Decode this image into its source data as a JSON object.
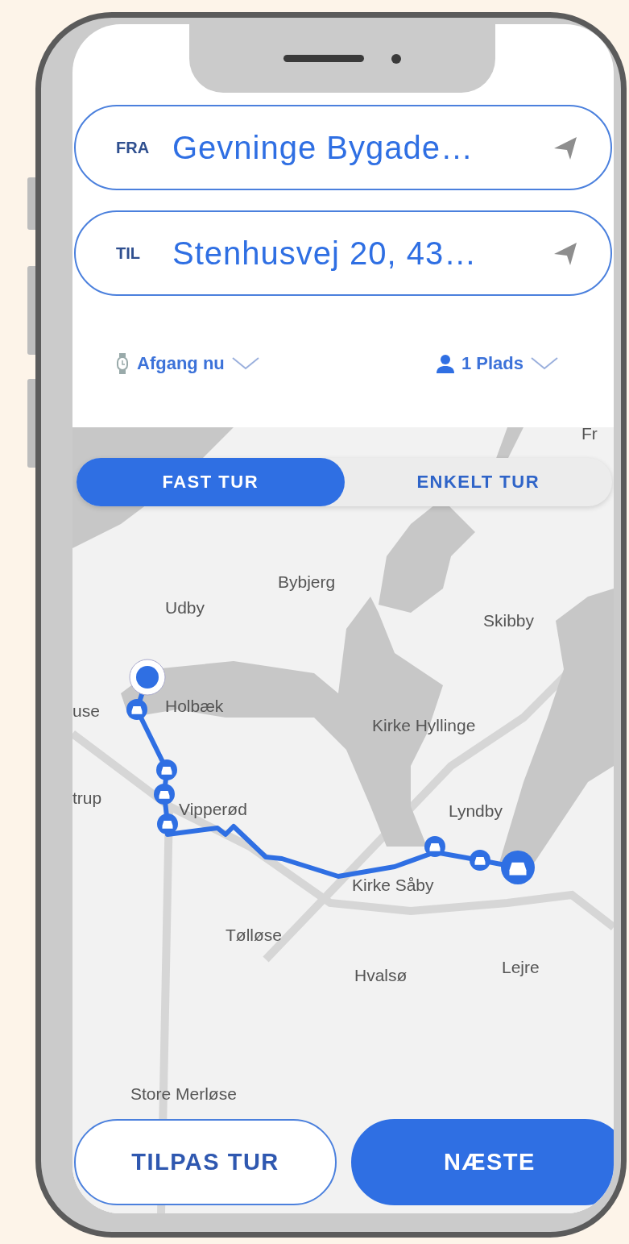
{
  "from": {
    "label": "FRA",
    "value": "Gevninge Bygade…"
  },
  "to": {
    "label": "TIL",
    "value": "Stenhusvej 20, 43…"
  },
  "options": [
    {
      "kind": "time",
      "label": "Afgang nu"
    },
    {
      "kind": "seats",
      "label": "1 Plads"
    }
  ],
  "trip_types": [
    {
      "label": "FAST TUR",
      "selected": true
    },
    {
      "label": "ENKELT TUR",
      "selected": false
    }
  ],
  "map": {
    "places": [
      "Fr",
      "Bybjerg",
      "Udby",
      "Skibby",
      "Holbæk",
      "use",
      "Kirke Hyllinge",
      "trup",
      "Vipperød",
      "Lyndby",
      "Kirke Såby",
      "Tølløse",
      "Lejre",
      "Hvalsø",
      "Store Merløse"
    ]
  },
  "buttons": [
    {
      "kind": "secondary",
      "label": "TILPAS TUR"
    },
    {
      "kind": "primary",
      "label": "NÆSTE"
    }
  ]
}
